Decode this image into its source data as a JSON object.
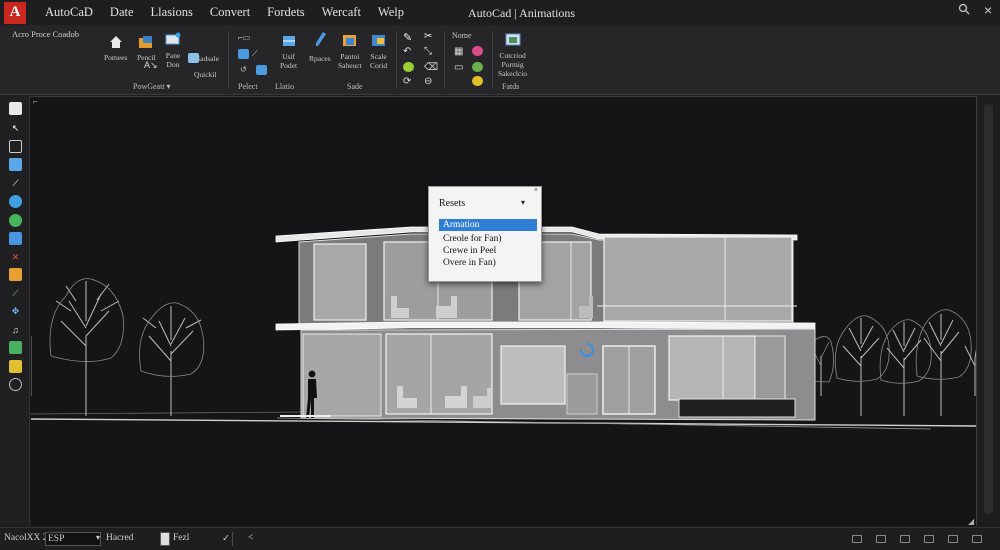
{
  "app": {
    "logo": "A",
    "title": "AutoCad | Animations"
  },
  "menu": [
    "AutoCaD",
    "Date",
    "Llasions",
    "Convert",
    "Fordets",
    "Wercaft",
    "Welp"
  ],
  "window_controls": {
    "search_icon": "search-icon",
    "close": "×"
  },
  "ribbon": {
    "top_left": "Acro  Proce Coadob",
    "home_label": "Pomees",
    "pencil_label": "Pencil",
    "draw_label": "Pane\nDon",
    "edit_label": "Sadsale",
    "quick_label": "Quickil",
    "grid_label": "Usif\nPodet",
    "fill_label": "Rpaces",
    "shade_label": "Pantoi\nSaheuct",
    "paint_label": "Scale\nCorid",
    "mode_label": "Nome",
    "layers_label": "Cutcriod\nPormig\nSakeclcio",
    "groups": [
      "PowGeatt ▾",
      "Pelect",
      "Llatio",
      "Sade",
      "Fatds"
    ]
  },
  "popup": {
    "title": "Resets",
    "options": [
      "Armation",
      "Creole for Fan)",
      "Crewe in Peel",
      "Overe in Fan)"
    ],
    "selected_index": 0
  },
  "status": {
    "coords_label": "NacolXX 25",
    "zoom_value": "ESP",
    "mode_value": "Hacred",
    "layer_value": "Fezl",
    "check": "✓",
    "arrow": "<"
  },
  "colors": {
    "accent": "#2f7fd6",
    "logo": "#c8281f",
    "background": "#151517"
  }
}
